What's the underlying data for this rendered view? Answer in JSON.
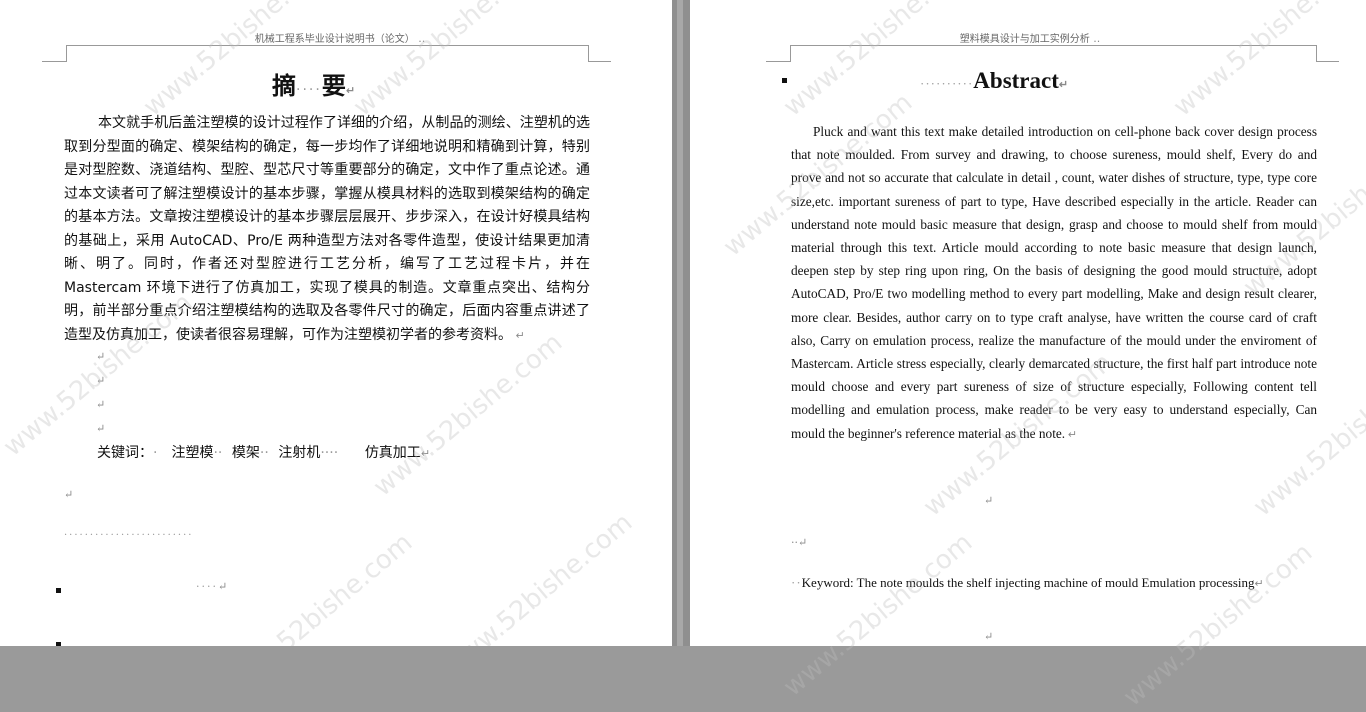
{
  "left_page": {
    "running_head": "机械工程系毕业设计说明书（论文）",
    "title_left": "摘",
    "title_right": "要",
    "body": "本文就手机后盖注塑模的设计过程作了详细的介绍，从制品的测绘、注塑机的选取到分型面的确定、模架结构的确定，每一步均作了详细地说明和精确到计算，特别是对型腔数、浇道结构、型腔、型芯尺寸等重要部分的确定，文中作了重点论述。通过本文读者可了解注塑模设计的基本步骤，掌握从模具材料的选取到模架结构的确定的基本方法。文章按注塑模设计的基本步骤层层展开、步步深入，在设计好模具结构的基础上，采用 AutoCAD、Pro/E 两种造型方法对各零件造型，使设计结果更加清晰、明了。同时，作者还对型腔进行工艺分析，编写了工艺过程卡片，并在 Mastercam 环境下进行了仿真加工，实现了模具的制造。文章重点突出、结构分明，前半部分重点介绍注塑模结构的选取及各零件尺寸的确定，后面内容重点讲述了造型及仿真加工，使读者很容易理解，可作为注塑模初学者的参考资料。",
    "keywords_label": "关键词：",
    "keywords": [
      "注塑模",
      "模架",
      "注射机",
      "仿真加工"
    ]
  },
  "right_page": {
    "running_head": "塑料模具设计与加工实例分析",
    "title": "Abstract",
    "body": "Pluck and want this text make detailed introduction on cell-phone back cover design process that note moulded. From survey and drawing, to choose sureness, mould shelf, Every do and prove and not so accurate that calculate in detail , count, water dishes of structure, type, type core size,etc. important sureness of part to type, Have described especially in the article. Reader can understand note mould basic measure that design, grasp and choose to mould shelf from mould material through this text. Article mould according to note basic measure that design launch, deepen step by step ring upon ring, On the basis of designing the good mould structure, adopt AutoCAD, Pro/E two modelling method to every part modelling, Make and design result clearer, more clear. Besides, author carry on to type craft analyse, have written the course card of craft also, Carry on emulation process, realize the manufacture of the mould under the enviroment of Mastercam. Article stress especially, clearly demarcated structure, the first half part introduce note mould choose and every part sureness of size of structure especially, Following content tell modelling and emulation process, make reader to be very easy to understand especially, Can mould the beginner's reference material as the note.",
    "keywords": "Keyword: The note moulds the shelf injecting machine of mould Emulation processing"
  },
  "watermark": "www.52bishe.com",
  "colors": {
    "background": "#9a9a9a",
    "page": "#ffffff",
    "text": "#111111",
    "mark": "#8a8a8a"
  }
}
